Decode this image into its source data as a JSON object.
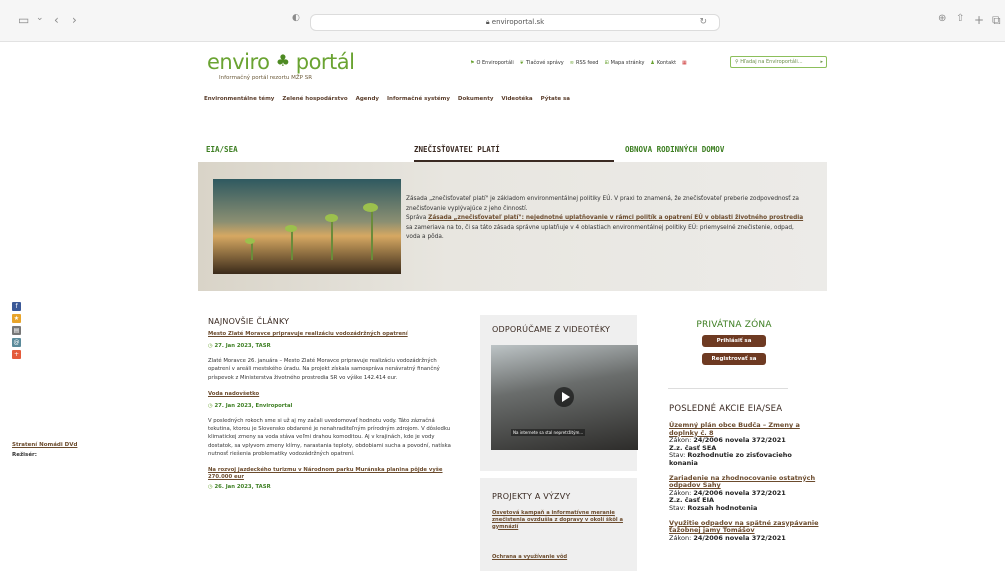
{
  "browser": {
    "url": "enviroportal.sk"
  },
  "header": {
    "logo_left": "enviro",
    "logo_right": "portál",
    "subtitle": "Informačný portál rezortu MŽP SR",
    "top_links": [
      "O Enviroportáli",
      "Tlačové správy",
      "RSS feed",
      "Mapa stránky",
      "Kontakt"
    ],
    "search_placeholder": "Hľadaj na Enviroportáli..."
  },
  "nav": [
    "Environmentálne témy",
    "Zelené hospodárstvo",
    "Agendy",
    "Informačné systémy",
    "Dokumenty",
    "Videotéka",
    "Pýtate sa"
  ],
  "tabs": [
    "EIA/SEA",
    "ZNEČISŤOVATEĽ PLATÍ",
    "OBNOVA RODINNÝCH DOMOV"
  ],
  "hero": {
    "p1": "Zásada „znečisťovateľ platí\" je základom environmentálnej politiky EÚ. V praxi to znamená, že znečisťovateľ preberie zodpovednosť za znečisťovanie vyplývajúce z jeho činností.",
    "p2_pre": "Správa ",
    "p2_link": "Zásada „znečisťovateľ platí\": nejednotné uplatňovanie v rámci politík a opatrení EÚ v oblasti životného prostredia",
    "p2_post": " sa zameriava na to, či sa táto zásada správne uplatňuje v 4 oblastiach environmentálnej politiky EÚ: priemyselné znečistenie, odpad, voda a pôda."
  },
  "news": {
    "title": "NAJNOVŠIE ČLÁNKY",
    "articles": [
      {
        "title": "Mesto Zlaté Moravce pripravuje realizáciu vodozádržných opatrení",
        "date": "27. Jan 2023, TASR",
        "text": "Zlaté Moravce 26. januára – Mesto Zlaté Moravce pripravuje realizáciu vodozádržných opatrení v areáli mestského úradu. Na projekt získala samospráva nenávratný finančný príspevok z Ministerstva životného prostredia SR vo výške 142.414 eur."
      },
      {
        "title": "Voda nadovšetko",
        "date": "27. Jan 2023, Enviroportal",
        "text": "V posledných rokoch sme si už aj my začali uvedomovať hodnotu vody. Táto zázračná tekutina, ktorou je Slovensko obdarené je nenahraditeľným prírodným zdrojom. V dôsledku klimatickej zmeny sa voda stáva veľmi drahou komoditou. Aj v krajinách, kde je vody dostatok, sa vplyvom zmeny klímy, narastania teploty, obdobiami sucha a povodní, natíska nutnosť riešenia problematiky vodozádržných opatrení."
      },
      {
        "title": "Na rozvoj jazdeckého turizmu v Národnom parku Muránska planina pôjde vyše 270.000 eur",
        "date": "26. Jan 2023, TASR",
        "text": ""
      }
    ]
  },
  "video": {
    "title": "ODPORÚČAME Z VIDEOTÉKY",
    "caption": "Na internete sa stal nepretržitým...",
    "link": "Stratení Nomádi DVd",
    "director_label": "Režisér:"
  },
  "projects": {
    "title": "PROJEKTY A VÝZVY",
    "items": [
      "Osvetová kampaň a informatívne meranie znečistenia ovzdušia z dopravy v okolí škôl a gymnázií",
      "Ochrana a využívanie vôd"
    ]
  },
  "private": {
    "title": "PRIVÁTNA ZÓNA",
    "login": "Prihlásiť sa",
    "register": "Registrovať sa"
  },
  "eia": {
    "title": "POSLEDNÉ AKCIE EIA/SEA",
    "items": [
      {
        "title": "Územný plán obce Budča – Zmeny a doplnky č. 8",
        "law_label": "Zákon:",
        "law": "24/2006 novela 372/2021",
        "part": "Z.z. časť SEA",
        "state_label": "Stav:",
        "state": "Rozhodnutie zo zisťovacieho konania"
      },
      {
        "title": "Zariadenie na zhodnocovanie ostatných odpadov Šahy",
        "law_label": "Zákon:",
        "law": "24/2006 novela 372/2021",
        "part": "Z.z. časť EIA",
        "state_label": "Stav:",
        "state": "Rozsah hodnotenia"
      },
      {
        "title": "Využitie odpadov na spätné zasypávanie ťažobnej jamy Tomášov",
        "law_label": "Zákon:",
        "law": "24/2006 novela 372/2021",
        "part": "",
        "state_label": "",
        "state": ""
      }
    ]
  },
  "colors": {
    "green": "#3c7e21",
    "brown": "#6b4b2d",
    "button": "#6e3a22"
  }
}
